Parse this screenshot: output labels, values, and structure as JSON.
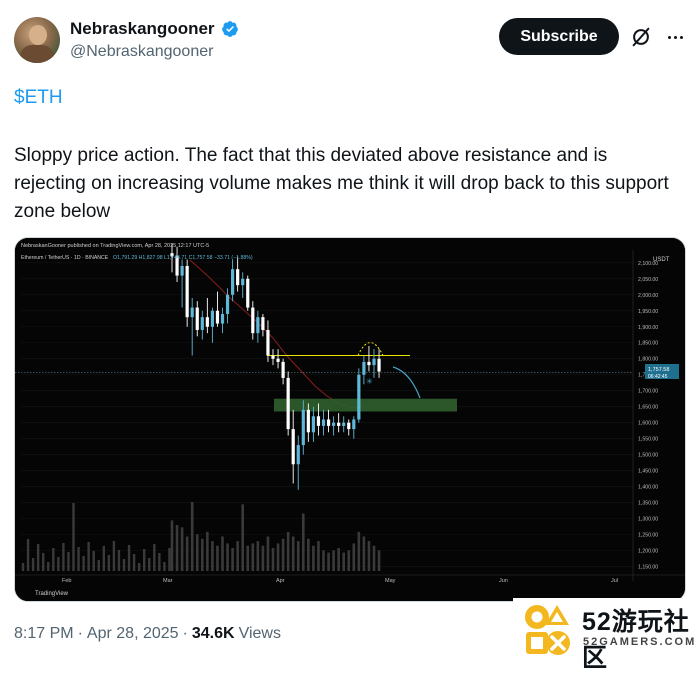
{
  "author": {
    "name": "Nebraskangooner",
    "handle": "@Nebraskangooner"
  },
  "actions": {
    "subscribe_label": "Subscribe"
  },
  "tweet": {
    "cashtag": "$ETH",
    "text": "Sloppy price action. The fact that this deviated above resistance and is rejecting on increasing volume makes me think it will drop back to this support zone below"
  },
  "chart_header": {
    "published": "NebraskanGooner published on TradingView.com, Apr 28, 2025 12:17 UTC-5",
    "symbol": "Ethereum / TetherUS · 1D · BINANCE",
    "ohlc": "O1,791.29 H1,827.98 L1,744.71 C1,757.58 −33.71 (−1.88%)",
    "currency": "USDT",
    "last_price": "1,757.58",
    "countdown": "06:42:45",
    "brand": "TradingView"
  },
  "chart_data": {
    "type": "candlestick",
    "x_labels": [
      "Feb",
      "Mar",
      "Apr",
      "May",
      "Jun",
      "Jul"
    ],
    "y_ticks": [
      "2,100.00",
      "2,050.00",
      "2,000.00",
      "1,950.00",
      "1,900.00",
      "1,850.00",
      "1,800.00",
      "1,750.00",
      "1,700.00",
      "1,650.00",
      "1,600.00",
      "1,550.00",
      "1,500.00",
      "1,450.00",
      "1,400.00",
      "1,350.00",
      "1,300.00",
      "1,250.00",
      "1,200.00",
      "1,150.00"
    ],
    "ylim": [
      1130,
      2115
    ],
    "resistance": 1810,
    "current_price": 1757.58,
    "support_zone": [
      1635,
      1675
    ],
    "candles": [
      [
        2130,
        2160,
        2070,
        2120
      ],
      [
        2120,
        2150,
        2040,
        2060
      ],
      [
        2060,
        2110,
        1960,
        2090
      ],
      [
        2090,
        2110,
        1900,
        1930
      ],
      [
        1930,
        1990,
        1810,
        1960
      ],
      [
        1960,
        1980,
        1870,
        1890
      ],
      [
        1890,
        1950,
        1860,
        1930
      ],
      [
        1930,
        1990,
        1880,
        1900
      ],
      [
        1900,
        1960,
        1850,
        1950
      ],
      [
        1950,
        2010,
        1900,
        1910
      ],
      [
        1910,
        1960,
        1880,
        1940
      ],
      [
        1940,
        2020,
        1910,
        2000
      ],
      [
        2000,
        2110,
        1980,
        2080
      ],
      [
        2080,
        2120,
        2010,
        2030
      ],
      [
        2030,
        2070,
        1990,
        2050
      ],
      [
        2050,
        2060,
        1950,
        1960
      ],
      [
        1960,
        1980,
        1860,
        1880
      ],
      [
        1880,
        1950,
        1850,
        1930
      ],
      [
        1930,
        1940,
        1870,
        1890
      ],
      [
        1890,
        1920,
        1790,
        1810
      ],
      [
        1810,
        1830,
        1780,
        1800
      ],
      [
        1800,
        1830,
        1770,
        1790
      ],
      [
        1790,
        1800,
        1720,
        1740
      ],
      [
        1740,
        1760,
        1560,
        1580
      ],
      [
        1580,
        1640,
        1410,
        1470
      ],
      [
        1470,
        1560,
        1390,
        1530
      ],
      [
        1530,
        1670,
        1500,
        1640
      ],
      [
        1640,
        1660,
        1540,
        1570
      ],
      [
        1570,
        1650,
        1540,
        1620
      ],
      [
        1620,
        1660,
        1560,
        1590
      ],
      [
        1590,
        1640,
        1560,
        1610
      ],
      [
        1610,
        1640,
        1570,
        1590
      ],
      [
        1590,
        1620,
        1560,
        1600
      ],
      [
        1600,
        1630,
        1570,
        1590
      ],
      [
        1590,
        1620,
        1570,
        1600
      ],
      [
        1600,
        1610,
        1560,
        1580
      ],
      [
        1580,
        1620,
        1550,
        1610
      ],
      [
        1610,
        1770,
        1600,
        1750
      ],
      [
        1750,
        1810,
        1720,
        1790
      ],
      [
        1790,
        1840,
        1760,
        1780
      ],
      [
        1780,
        1830,
        1740,
        1800
      ],
      [
        1800,
        1830,
        1740,
        1760
      ]
    ],
    "volume": [
      44,
      40,
      38,
      30,
      60,
      32,
      28,
      34,
      26,
      22,
      30,
      24,
      20,
      26,
      58,
      22,
      24,
      26,
      22,
      30,
      20,
      24,
      28,
      34,
      30,
      26,
      50,
      28,
      22,
      26,
      18,
      16,
      18,
      20,
      16,
      18,
      24,
      34,
      30,
      26,
      22,
      18
    ],
    "projection": "drop back to support zone"
  },
  "footer": {
    "time": "8:17 PM",
    "sep": "·",
    "date": "Apr 28, 2025",
    "views_count": "34.6K",
    "views_label": "Views"
  },
  "watermark": {
    "text": "52游玩社区",
    "sub": "52GAMERS.COM"
  },
  "colors": {
    "accent": "#1d9bf0",
    "up": "#5fb8d8",
    "down": "#ffffff",
    "resistance": "#e8e600",
    "support": "#2f5f2f"
  },
  "icons": [
    "verified-badge-icon",
    "grok-icon",
    "more-options-icon"
  ]
}
